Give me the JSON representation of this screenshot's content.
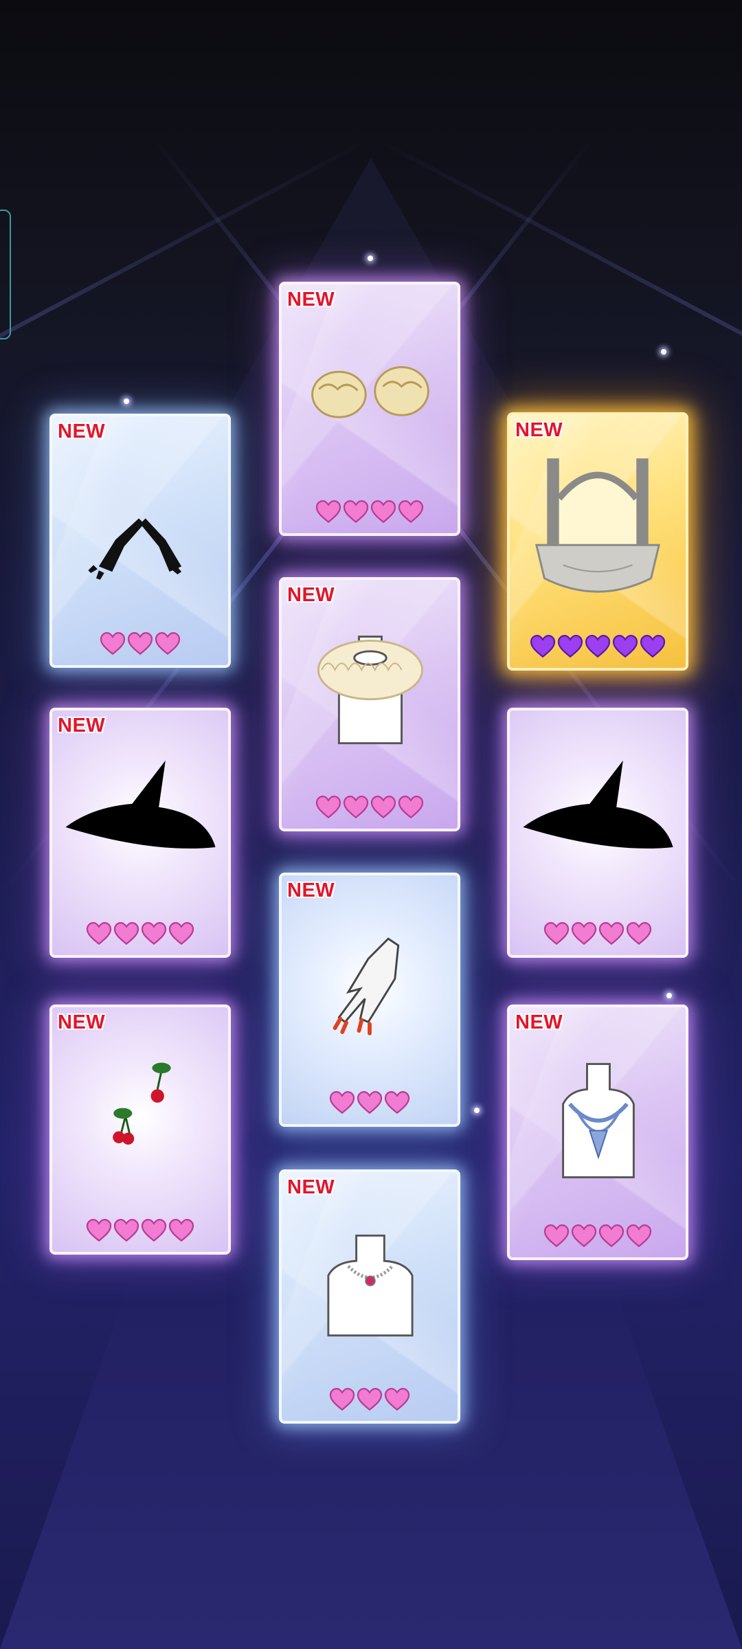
{
  "screen": "gacha-results",
  "colors": {
    "pink_heart": "#f37cd3",
    "purple_heart": "#9b3ff0",
    "new_badge": "#e3152b",
    "gold_glow": "#f6c13e",
    "purple_glow": "#c9a8ee",
    "blue_glow": "#b9ccf2"
  },
  "cards": [
    {
      "id": "gloves",
      "badge": "NEW",
      "item_icon": "black-gloves-icon",
      "rarity_hearts": 3,
      "heart_color": "pink",
      "frame": "blue-crystal"
    },
    {
      "id": "cuffs",
      "badge": "NEW",
      "item_icon": "gold-cuffs-icon",
      "rarity_hearts": 4,
      "heart_color": "pink",
      "frame": "purple-crystal"
    },
    {
      "id": "balcony",
      "badge": "NEW",
      "item_icon": "arch-balcony-icon",
      "rarity_hearts": 5,
      "heart_color": "purple",
      "frame": "gold-crystal"
    },
    {
      "id": "ruff-collar",
      "badge": "NEW",
      "item_icon": "ruff-collar-icon",
      "rarity_hearts": 4,
      "heart_color": "pink",
      "frame": "purple-crystal"
    },
    {
      "id": "witch-hat-1",
      "badge": "NEW",
      "item_icon": "witch-hat-icon",
      "rarity_hearts": 4,
      "heart_color": "pink",
      "frame": "purple-soft"
    },
    {
      "id": "witch-hat-2",
      "badge": "",
      "item_icon": "witch-hat-icon",
      "rarity_hearts": 4,
      "heart_color": "pink",
      "frame": "purple-soft"
    },
    {
      "id": "nails",
      "badge": "NEW",
      "item_icon": "red-nails-hand-icon",
      "rarity_hearts": 3,
      "heart_color": "pink",
      "frame": "blue-soft"
    },
    {
      "id": "cherries",
      "badge": "NEW",
      "item_icon": "cherry-earrings-icon",
      "rarity_hearts": 4,
      "heart_color": "pink",
      "frame": "purple-soft"
    },
    {
      "id": "blue-necklace",
      "badge": "NEW",
      "item_icon": "blue-jewel-necklace-icon",
      "rarity_hearts": 4,
      "heart_color": "pink",
      "frame": "purple-crystal"
    },
    {
      "id": "pearl-choker",
      "badge": "NEW",
      "item_icon": "pearl-choker-icon",
      "rarity_hearts": 3,
      "heart_color": "pink",
      "frame": "blue-crystal"
    }
  ]
}
